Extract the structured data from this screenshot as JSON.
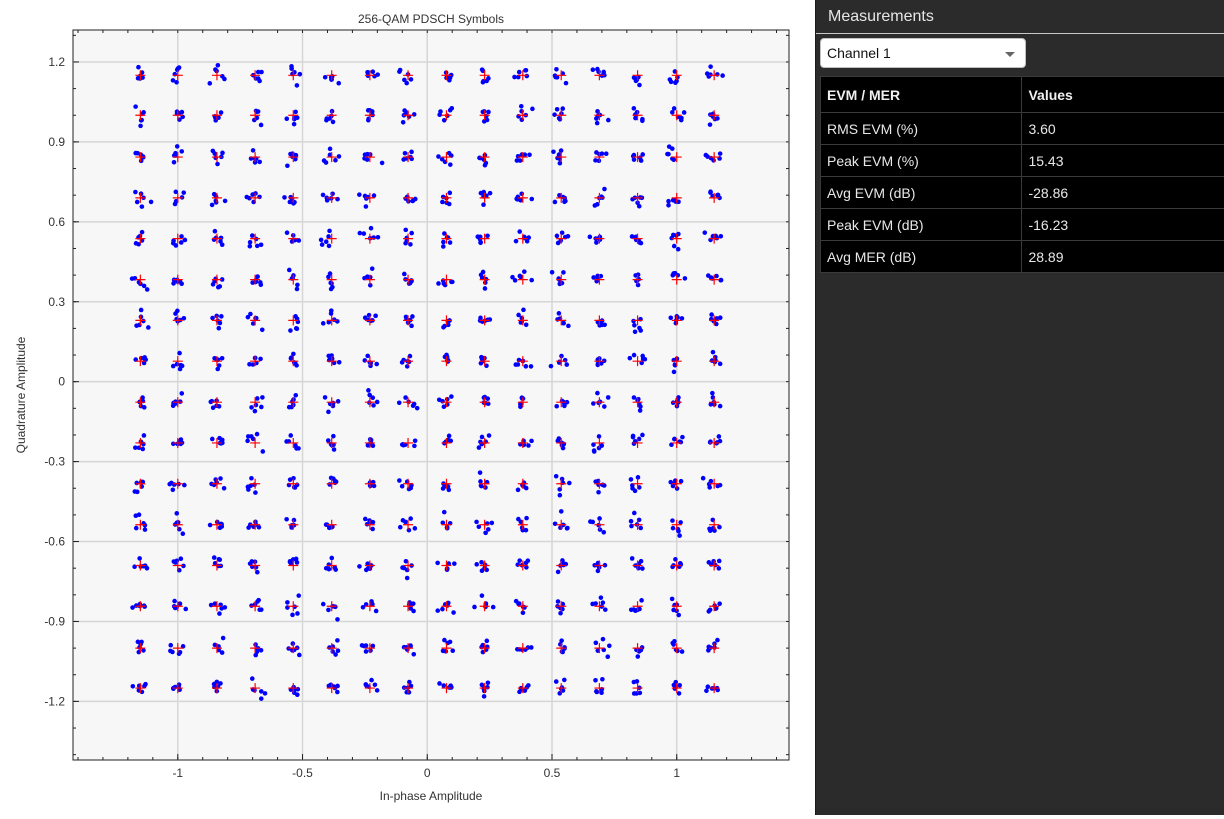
{
  "measurements_panel": {
    "title": "Measurements",
    "channel_select": {
      "value": "Channel 1"
    },
    "table": {
      "headers": [
        "EVM / MER",
        "Values"
      ],
      "rows": [
        {
          "label": "RMS EVM (%)",
          "value": "3.60"
        },
        {
          "label": "Peak EVM (%)",
          "value": "15.43"
        },
        {
          "label": "Avg EVM (dB)",
          "value": "-28.86"
        },
        {
          "label": "Peak EVM (dB)",
          "value": "-16.23"
        },
        {
          "label": "Avg MER (dB)",
          "value": "28.89"
        }
      ]
    }
  },
  "colors": {
    "symbol_points": "#0000ff",
    "reference_markers": "#ff0000",
    "plot_background": "#f7f7f7",
    "panel_background": "#2b2b2b",
    "table_background": "#000000"
  },
  "chart_data": {
    "type": "scatter",
    "title": "256-QAM PDSCH Symbols",
    "xlabel": "In-phase Amplitude",
    "ylabel": "Quadrature Amplitude",
    "xlim": [
      -1.42,
      1.45
    ],
    "ylim": [
      -1.42,
      1.32
    ],
    "xticks": [
      -1,
      -0.5,
      0,
      0.5,
      1
    ],
    "xtick_labels": [
      "-1",
      "-0.5",
      "0",
      "0.5",
      "1"
    ],
    "yticks": [
      -1.2,
      -0.9,
      -0.6,
      -0.3,
      0,
      0.3,
      0.6,
      0.9,
      1.2
    ],
    "ytick_labels": [
      "-1.2",
      "-0.9",
      "-0.6",
      "-0.3",
      "0",
      "0.3",
      "0.6",
      "0.9",
      "1.2"
    ],
    "grid": true,
    "series": [
      {
        "role": "reference constellation (+ markers)",
        "levels": [
          -1.15,
          -1.0,
          -0.843,
          -0.69,
          -0.537,
          -0.383,
          -0.23,
          -0.077,
          0.077,
          0.23,
          0.383,
          0.537,
          0.69,
          0.843,
          1.0,
          1.15
        ]
      },
      {
        "role": "received symbols (dots)",
        "points_per_constellation_point": 6,
        "spread": 0.04
      }
    ]
  }
}
